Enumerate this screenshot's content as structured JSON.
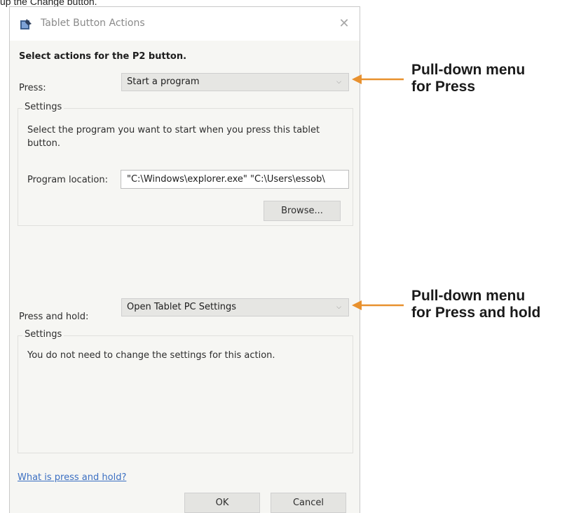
{
  "page": {
    "top_cut_text": "up the Change button."
  },
  "dialog": {
    "title": "Tablet Button Actions",
    "close_symbol": "✕",
    "heading": "Select actions for the P2 button.",
    "press": {
      "label": "Press:",
      "selected": "Start a program",
      "settings_title": "Settings",
      "settings_description": "Select the program you want to start when you press this tablet button.",
      "program_location_label": "Program location:",
      "program_location_value": "\"C:\\Windows\\explorer.exe\" \"C:\\Users\\essob\\",
      "browse_label": "Browse..."
    },
    "press_and_hold": {
      "label": "Press and hold:",
      "selected": "Open Tablet PC Settings",
      "settings_title": "Settings",
      "settings_description": "You do not need to change the settings for this action."
    },
    "help_link": "What is press and hold?",
    "ok_label": "OK",
    "cancel_label": "Cancel"
  },
  "callouts": {
    "press": [
      "Pull-down menu",
      "for Press"
    ],
    "press_and_hold": [
      "Pull-down menu",
      "for Press and hold"
    ],
    "arrow_color": "#e8912e"
  }
}
